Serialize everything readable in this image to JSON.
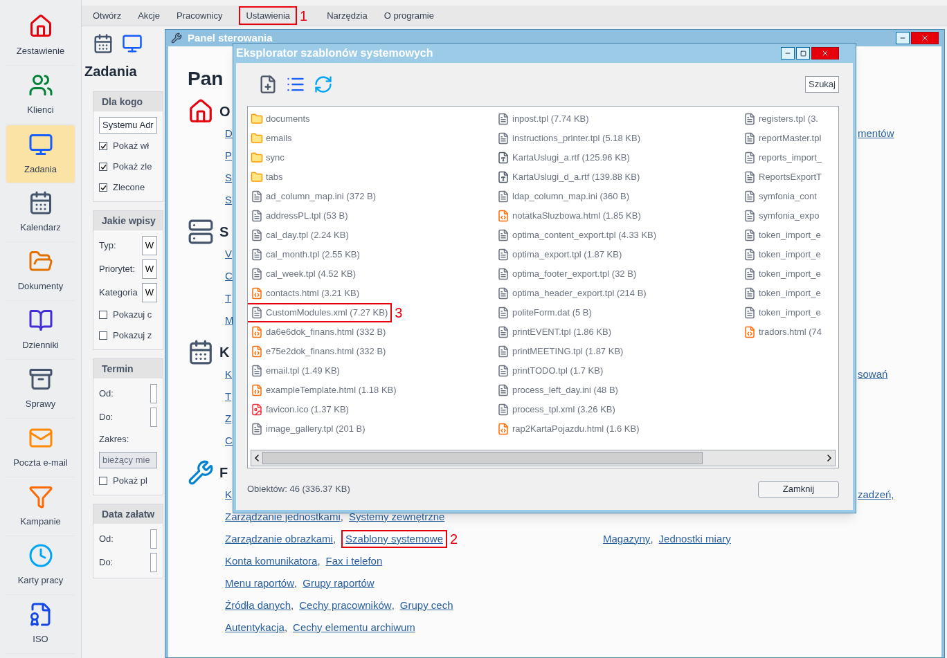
{
  "sidebar": {
    "items": [
      {
        "label": "Zestawienie",
        "selected": false
      },
      {
        "label": "Klienci",
        "selected": false
      },
      {
        "label": "Zadania",
        "selected": true
      },
      {
        "label": "Kalendarz",
        "selected": false
      },
      {
        "label": "Dokumenty",
        "selected": false
      },
      {
        "label": "Dzienniki",
        "selected": false
      },
      {
        "label": "Sprawy",
        "selected": false
      },
      {
        "label": "Poczta e-mail",
        "selected": false
      },
      {
        "label": "Kampanie",
        "selected": false
      },
      {
        "label": "Karty pracy",
        "selected": false
      },
      {
        "label": "ISO",
        "selected": false
      }
    ]
  },
  "menu": {
    "items": [
      {
        "label": "Otwórz"
      },
      {
        "label": "Akcje"
      },
      {
        "label": "Pracownicy"
      },
      {
        "label": "Ustawienia",
        "callout": "1"
      },
      {
        "label": "Narzędzia"
      },
      {
        "label": "O programie"
      }
    ]
  },
  "filters": {
    "title": "Zadania",
    "groups": [
      {
        "title": "Dla kogo",
        "fields": [
          {
            "kind": "select",
            "value": "Systemu Adr",
            "disabled": false
          },
          {
            "kind": "checkbox",
            "label": "Pokaż wł",
            "checked": true
          },
          {
            "kind": "checkbox",
            "label": "Pokaż zle",
            "checked": true
          },
          {
            "kind": "checkbox",
            "label": "Zlecone",
            "checked": true
          }
        ]
      },
      {
        "title": "Jakie wpisy",
        "fields": [
          {
            "kind": "labeled",
            "label": "Typ:",
            "value": "W"
          },
          {
            "kind": "labeled",
            "label": "Priorytet:",
            "value": "W"
          },
          {
            "kind": "labeled",
            "label": "Kategoria",
            "value": "W"
          },
          {
            "kind": "checkbox",
            "label": "Pokazuj c",
            "checked": false
          },
          {
            "kind": "checkbox",
            "label": "Pokazuj z",
            "checked": false
          }
        ]
      },
      {
        "title": "Termin",
        "fields": [
          {
            "kind": "labeled",
            "label": "Od:"
          },
          {
            "kind": "labeled",
            "label": "Do:"
          },
          {
            "kind": "label",
            "label": "Zakres:"
          },
          {
            "kind": "select",
            "value": "bieżący mie",
            "disabled": true
          },
          {
            "kind": "checkbox",
            "label": "Pokaż pl",
            "checked": false
          }
        ]
      },
      {
        "title": "Data załatw",
        "fields": [
          {
            "kind": "labeled",
            "label": "Od:"
          },
          {
            "kind": "labeled",
            "label": "Do:"
          }
        ]
      }
    ]
  },
  "panel": {
    "title": "Panel sterowania",
    "heading": "Pan",
    "separator": ",",
    "sections": [
      {
        "heading": "O",
        "rows": [
          {
            "links": [
              {
                "text": "D"
              }
            ],
            "fragment": "mentów"
          },
          {
            "links": [
              {
                "text": "P"
              }
            ]
          },
          {
            "links": [
              {
                "text": "S"
              }
            ]
          },
          {
            "links": [
              {
                "text": "S"
              }
            ]
          }
        ]
      },
      {
        "heading": "S",
        "rows": [
          {
            "links": [
              {
                "text": "V"
              }
            ]
          },
          {
            "links": [
              {
                "text": "C"
              }
            ]
          },
          {
            "links": [
              {
                "text": "T"
              }
            ]
          },
          {
            "links": [
              {
                "text": "M"
              }
            ]
          }
        ]
      },
      {
        "heading": "K",
        "rows": [
          {
            "links": [
              {
                "text": "K"
              }
            ],
            "fragment": "sowań"
          },
          {
            "links": [
              {
                "text": "T"
              }
            ]
          },
          {
            "links": [
              {
                "text": "Z"
              }
            ]
          },
          {
            "links": [
              {
                "text": "C"
              }
            ]
          }
        ]
      },
      {
        "heading": "F",
        "rows": [
          {
            "links": [
              {
                "text": "K"
              }
            ],
            "fragment": "zadzeń,"
          },
          {
            "links": [
              {
                "text": "Zarządzanie jednostkami"
              },
              {
                "text": "Systemy zewnętrzne"
              }
            ]
          },
          {
            "links": [
              {
                "text": "Zarządzanie obrazkami"
              },
              {
                "text": "Szablony systemowe",
                "callout": "2"
              }
            ],
            "links_right": [
              {
                "text": "Magazyny"
              },
              {
                "text": "Jednostki miary"
              }
            ]
          },
          {
            "links": [
              {
                "text": "Konta komunikatora"
              },
              {
                "text": "Fax i telefon"
              }
            ]
          },
          {
            "links": [
              {
                "text": "Menu raportów"
              },
              {
                "text": "Grupy raportów"
              }
            ]
          },
          {
            "links": [
              {
                "text": "Źródła danych"
              },
              {
                "text": "Cechy pracowników"
              },
              {
                "text": "Grupy cech"
              }
            ]
          },
          {
            "links": [
              {
                "text": "Autentykacja"
              },
              {
                "text": "Cechy elementu archiwum"
              }
            ]
          }
        ]
      }
    ]
  },
  "dialog": {
    "title": "Eksplorator szablonów systemowych",
    "search_button": "Szukaj",
    "columns": [
      [
        {
          "name": "documents",
          "kind": "folder"
        },
        {
          "name": "emails",
          "kind": "folder"
        },
        {
          "name": "sync",
          "kind": "folder"
        },
        {
          "name": "tabs",
          "kind": "folder"
        },
        {
          "name": "ad_column_map.ini (372 B)",
          "kind": "text"
        },
        {
          "name": "addressPL.tpl (53 B)",
          "kind": "text"
        },
        {
          "name": "cal_day.tpl (2.24 KB)",
          "kind": "text"
        },
        {
          "name": "cal_month.tpl (2.55 KB)",
          "kind": "text"
        },
        {
          "name": "cal_week.tpl (4.52 KB)",
          "kind": "text"
        },
        {
          "name": "contacts.html (3.21 KB)",
          "kind": "html"
        },
        {
          "name": "CustomModules.xml (7.27 KB)",
          "kind": "text",
          "callout": "3"
        },
        {
          "name": "da6e6dok_finans.html (332 B)",
          "kind": "html"
        },
        {
          "name": "e75e2dok_finans.html (332 B)",
          "kind": "html"
        },
        {
          "name": "email.tpl (1.49 KB)",
          "kind": "text"
        },
        {
          "name": "exampleTemplate.html (1.18 KB)",
          "kind": "html"
        },
        {
          "name": "favicon.ico (1.37 KB)",
          "kind": "image"
        },
        {
          "name": "image_gallery.tpl (201 B)",
          "kind": "text"
        }
      ],
      [
        {
          "name": "inpost.tpl (7.74 KB)",
          "kind": "text"
        },
        {
          "name": "instructions_printer.tpl (5.18 KB)",
          "kind": "text"
        },
        {
          "name": "KartaUslugi_a.rtf (125.96 KB)",
          "kind": "rtf"
        },
        {
          "name": "KartaUslugi_d_a.rtf (139.88 KB)",
          "kind": "rtf"
        },
        {
          "name": "ldap_column_map.ini (360 B)",
          "kind": "text"
        },
        {
          "name": "notatkaSluzbowa.html (1.85 KB)",
          "kind": "html"
        },
        {
          "name": "optima_content_export.tpl (4.33 KB)",
          "kind": "text"
        },
        {
          "name": "optima_export.tpl (1.87 KB)",
          "kind": "text"
        },
        {
          "name": "optima_footer_export.tpl (32 B)",
          "kind": "text"
        },
        {
          "name": "optima_header_export.tpl (214 B)",
          "kind": "text"
        },
        {
          "name": "politeForm.dat (5 B)",
          "kind": "text"
        },
        {
          "name": "printEVENT.tpl (1.86 KB)",
          "kind": "text"
        },
        {
          "name": "printMEETING.tpl (1.87 KB)",
          "kind": "text"
        },
        {
          "name": "printTODO.tpl (1.7 KB)",
          "kind": "text"
        },
        {
          "name": "process_left_day.ini (48 B)",
          "kind": "text"
        },
        {
          "name": "process_tpl.xml (3.26 KB)",
          "kind": "text"
        },
        {
          "name": "rap2KartaPojazdu.html (1.6 KB)",
          "kind": "html"
        }
      ],
      [
        {
          "name": "registers.tpl (3.",
          "kind": "text"
        },
        {
          "name": "reportMaster.tpl",
          "kind": "text"
        },
        {
          "name": "reports_import_",
          "kind": "text"
        },
        {
          "name": "ReportsExportT",
          "kind": "text"
        },
        {
          "name": "symfonia_cont",
          "kind": "text"
        },
        {
          "name": "symfonia_expo",
          "kind": "text"
        },
        {
          "name": "token_import_e",
          "kind": "text"
        },
        {
          "name": "token_import_e",
          "kind": "text"
        },
        {
          "name": "token_import_e",
          "kind": "text"
        },
        {
          "name": "token_import_e",
          "kind": "text"
        },
        {
          "name": "token_import_e",
          "kind": "text"
        },
        {
          "name": "tradors.html (74",
          "kind": "html"
        }
      ]
    ],
    "status": "Obiektów: 46 (336.37 KB)",
    "close_button": "Zamknij"
  }
}
